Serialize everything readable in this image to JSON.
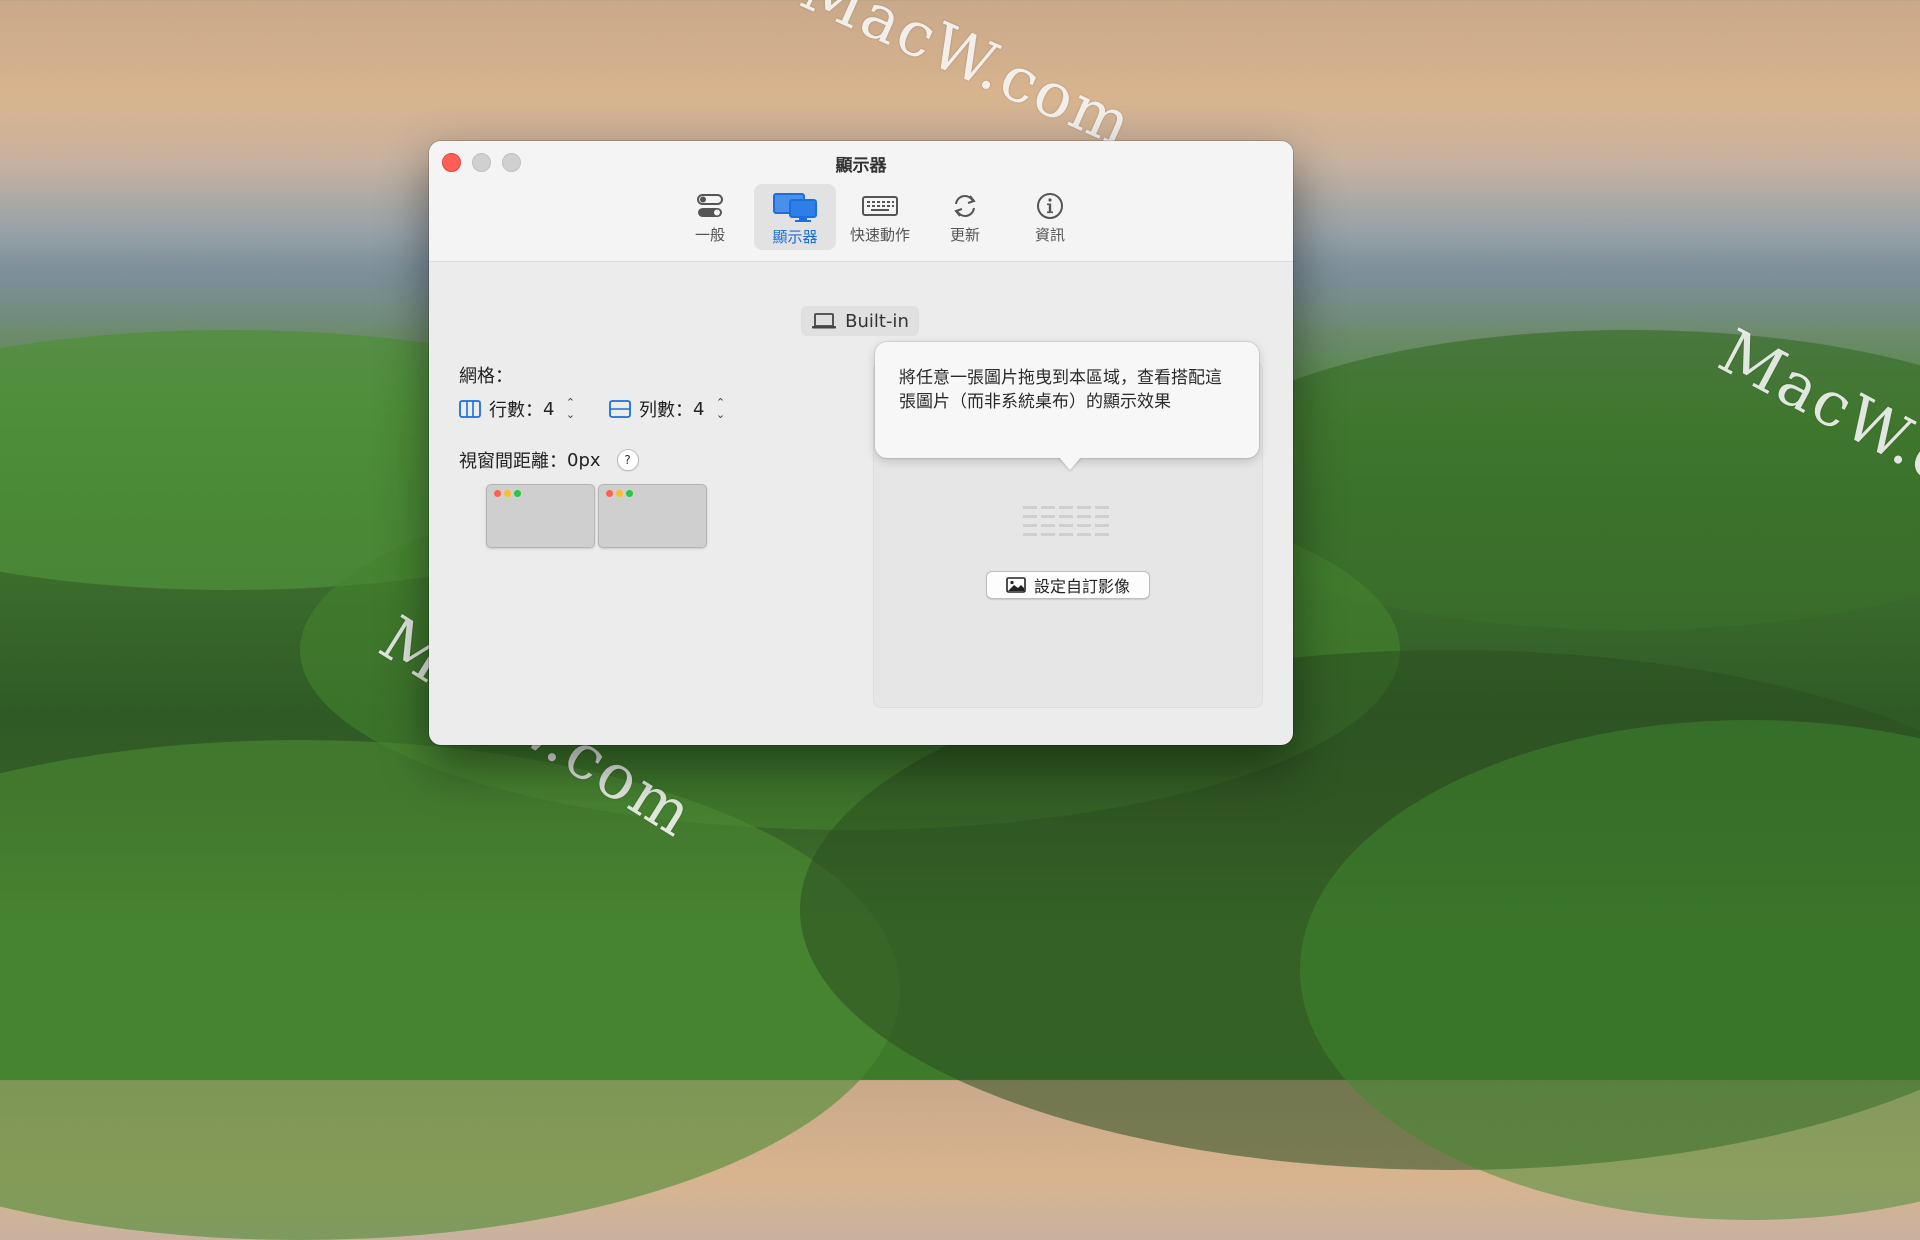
{
  "watermark": {
    "text1": "MacW.com",
    "text2": "MacW.c",
    "text3": "MacW.com"
  },
  "window": {
    "title": "顯示器",
    "tabs": [
      {
        "label": "一般",
        "icon": "toggle-icon"
      },
      {
        "label": "顯示器",
        "icon": "display-icon",
        "active": true
      },
      {
        "label": "快速動作",
        "icon": "keyboard-icon"
      },
      {
        "label": "更新",
        "icon": "refresh-icon"
      },
      {
        "label": "資訊",
        "icon": "info-icon"
      }
    ]
  },
  "display": {
    "name": "Built-in",
    "icon": "laptop-icon"
  },
  "grid": {
    "label": "網格：",
    "rows_label": "行數：",
    "rows_value": "4",
    "cols_label": "列數：",
    "cols_value": "4"
  },
  "gap": {
    "label": "視窗間距離：",
    "value": "0px",
    "help": "?"
  },
  "drop_zone": {
    "tooltip": "將任意一張圖片拖曳到本區域，查看搭配這張圖片（而非系統桌布）的顯示效果",
    "button_label": "設定自訂影像"
  },
  "colors": {
    "accent": "#1a6fe0",
    "close": "#ff5f57"
  }
}
